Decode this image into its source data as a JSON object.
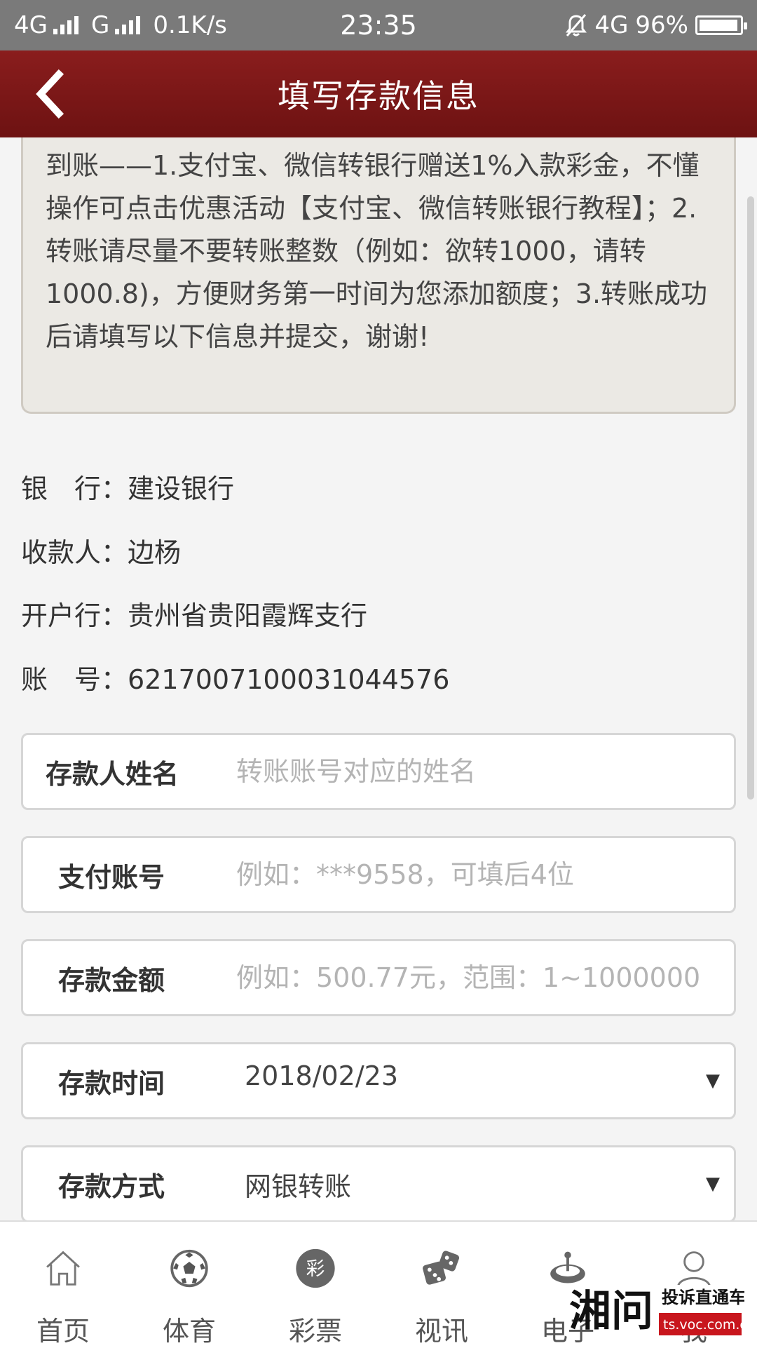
{
  "status_bar": {
    "network_1": "4G",
    "network_2": "G",
    "speed": "0.1K/s",
    "time": "23:35",
    "network_3": "4G",
    "battery": "96%",
    "battery_level": 0.96
  },
  "header": {
    "title": "填写存款信息"
  },
  "notice": {
    "text": "到账——1.支付宝、微信转银行赠送1%入款彩金，不懂操作可点击优惠活动【支付宝、微信转账银行教程】；2.转账请尽量不要转账整数（例如：欲转1000，请转1000.8)，方便财务第一时间为您添加额度；3.转账成功后请填写以下信息并提交，谢谢!"
  },
  "bank_info": {
    "bank_label": "银　行：",
    "bank_value": "建设银行",
    "payee_label": "收款人：",
    "payee_value": "边杨",
    "branch_label": "开户行：",
    "branch_value": "贵州省贵阳霞辉支行",
    "account_label": "账　号：",
    "account_value": "6217007100031044576"
  },
  "form": {
    "depositor_name": {
      "label": "存款人姓名",
      "placeholder": "转账账号对应的姓名"
    },
    "pay_account": {
      "label": "支付账号",
      "placeholder": "例如：***9558，可填后4位"
    },
    "amount": {
      "label": "存款金额",
      "placeholder": "例如：500.77元，范围：1~1000000"
    },
    "deposit_time": {
      "label": "存款时间",
      "value": "2018/02/23"
    },
    "deposit_method": {
      "label": "存款方式",
      "value": "网银转账"
    }
  },
  "bottom_nav": [
    {
      "label": "首页",
      "icon": "home-icon"
    },
    {
      "label": "体育",
      "icon": "soccer-ball-icon"
    },
    {
      "label": "彩票",
      "icon": "lottery-icon",
      "icon_text": "彩"
    },
    {
      "label": "视讯",
      "icon": "dice-icon"
    },
    {
      "label": "电子",
      "icon": "roulette-icon"
    },
    {
      "label": "我",
      "icon": "user-icon"
    }
  ],
  "watermark": {
    "brand": "湘问",
    "tagline": "投诉直通车",
    "url": "ts.voc.com.cn"
  },
  "colors": {
    "header": "#7a1717",
    "status_bar": "#7a7a7a",
    "background": "#f4f4f4"
  }
}
